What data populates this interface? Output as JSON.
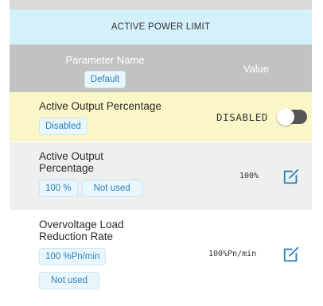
{
  "panel": {
    "title": "ACTIVE POWER LIMIT"
  },
  "header": {
    "parameter_name_label": "Parameter Name",
    "default_chip": "Default",
    "value_label": "Value"
  },
  "rows": [
    {
      "name": "Active Output Percentage",
      "chips": [
        "Disabled"
      ],
      "value": "DISABLED",
      "control": "toggle",
      "toggle_on": false
    },
    {
      "name": "Active Output Percentage",
      "chips": [
        "100 %",
        "Not used"
      ],
      "value": "100%",
      "control": "edit-icon"
    },
    {
      "name": "Overvoltage Load Reduction Rate",
      "chips": [
        "100 %Pn/min",
        "Not used"
      ],
      "value": "100%Pn/min",
      "control": "edit-icon"
    }
  ],
  "colors": {
    "title_bar_bg": "#d4f1fb",
    "header_bg": "#c2c2c2",
    "highlight_row_bg": "#fbf6c7",
    "chip_text": "#2d7fb8",
    "edit_icon": "#2d7fb8",
    "toggle_track": "#555555"
  }
}
